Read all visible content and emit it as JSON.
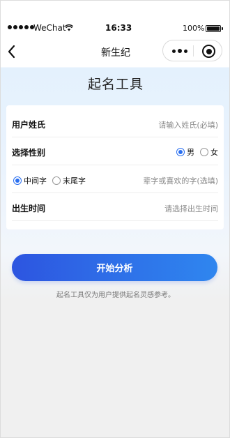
{
  "status_bar": {
    "carrier": "WeChat",
    "time": "16:33",
    "battery": "100%"
  },
  "nav": {
    "title": "新生纪"
  },
  "page": {
    "title": "起名工具"
  },
  "form": {
    "surname": {
      "label": "用户姓氏",
      "placeholder": "请输入姓氏(必填)"
    },
    "gender": {
      "label": "选择性别",
      "options": [
        "男",
        "女"
      ],
      "selected": "男"
    },
    "char_position": {
      "options": [
        "中间字",
        "末尾字"
      ],
      "selected": "中间字",
      "placeholder": "辈字或喜欢的字(选填)"
    },
    "birth_time": {
      "label": "出生时间",
      "placeholder": "请选择出生时间"
    }
  },
  "actions": {
    "start_label": "开始分析"
  },
  "footer": {
    "disclaimer": "起名工具仅为用户提供起名灵感参考。"
  },
  "colors": {
    "accent": "#2a6ff0",
    "button_start": "#2d55e0",
    "button_end": "#2f86ef"
  }
}
